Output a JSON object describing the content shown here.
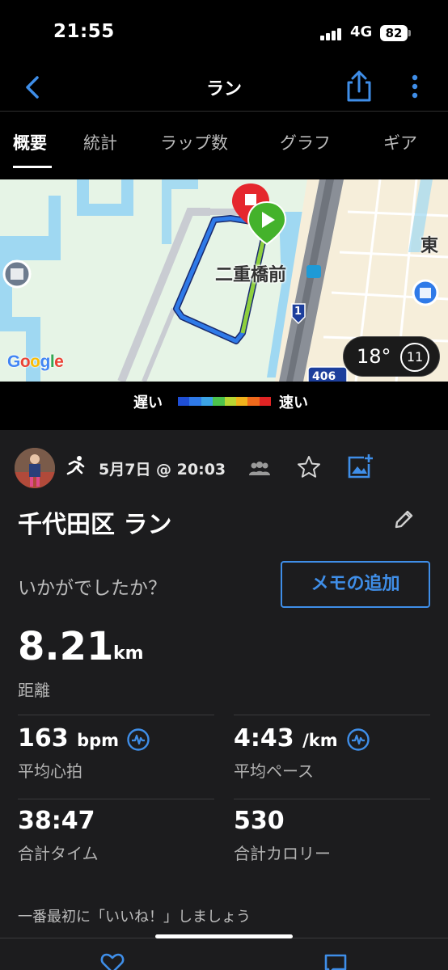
{
  "status_bar": {
    "time": "21:55",
    "network": "4G",
    "battery": "82"
  },
  "nav": {
    "title": "ラン",
    "back_icon": "chevron-left-icon",
    "share_icon": "share-icon",
    "more_icon": "more-vertical-icon"
  },
  "tabs": [
    {
      "label": "概要",
      "active": true
    },
    {
      "label": "統計",
      "active": false
    },
    {
      "label": "ラップ数",
      "active": false
    },
    {
      "label": "グラフ",
      "active": false
    },
    {
      "label": "ギア",
      "active": false
    }
  ],
  "map": {
    "station_label": "二重橋前",
    "east_label": "東",
    "route_label": "1",
    "highway_label": "406",
    "google_logo": "Google",
    "weather": {
      "temperature": "18°",
      "wind": "11"
    }
  },
  "legend": {
    "slow": "遅い",
    "fast": "速い",
    "colors": [
      "#1f4fd6",
      "#2f7ae8",
      "#3ca4e6",
      "#4cc34c",
      "#b8d632",
      "#f0b21c",
      "#f06a1c",
      "#e02424"
    ]
  },
  "activity": {
    "date": "5月7日 @ 20:03",
    "title": "千代田区 ラン",
    "feedback_question": "いかがでしたか？",
    "memo_button": "メモの追加",
    "distance": {
      "value": "8.21",
      "unit": "km",
      "label": "距離"
    },
    "stats": [
      {
        "value": "163",
        "unit": "bpm",
        "label": "平均心拍",
        "has_icon": true
      },
      {
        "value": "4:43",
        "unit": "/km",
        "label": "平均ペース",
        "has_icon": true
      },
      {
        "value": "38:47",
        "unit": "",
        "label": "合計タイム",
        "has_icon": false
      },
      {
        "value": "530",
        "unit": "",
        "label": "合計カロリー",
        "has_icon": false
      }
    ],
    "like_prompt": "一番最初に「いいね！」しましょう"
  },
  "colors": {
    "accent": "#3f8ee8",
    "background": "#000000",
    "card": "#1c1c1e"
  }
}
